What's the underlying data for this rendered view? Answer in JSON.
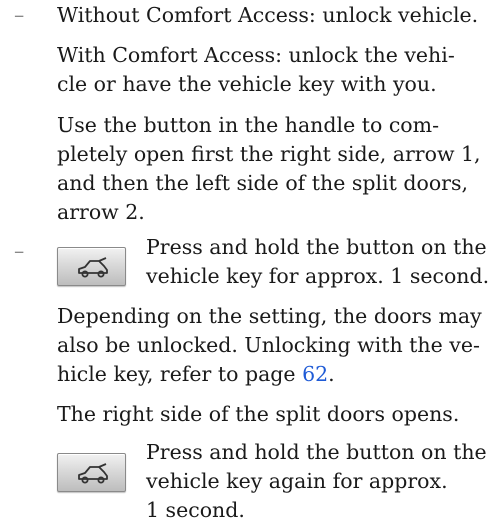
{
  "list": {
    "bullet": "–"
  },
  "step1": {
    "line1": "Without Comfort Access: unlock vehicle.",
    "para2": [
      "With Comfort Access: unlock the vehi-",
      "cle or have the vehicle key with you."
    ],
    "para3": [
      "Use the button in the handle to com-",
      "pletely open first the right side, arrow 1,",
      "and then the left side of the split doors,",
      "arrow 2."
    ]
  },
  "step2": {
    "key_button_icon": "car-tailgate-icon",
    "key_text": [
      "Press and hold the button on the",
      "vehicle key for approx. 1 second."
    ],
    "para_a_line1": "Depending on the setting, the doors may",
    "para_a_line2": "also be unlocked. Unlocking with the ve-",
    "para_a_line3_prefix": "hicle key, refer to page ",
    "page_ref": "62",
    "para_a_line3_suffix": ".",
    "para_b": "The right side of the split doors opens.",
    "key_button2_icon": "car-tailgate-icon",
    "key_text2": [
      "Press and hold the button on the",
      "vehicle key again for approx.",
      "1 second."
    ]
  },
  "colors": {
    "text": "#1a1a1a",
    "link": "#1f5bd6",
    "bullet": "#888888"
  }
}
